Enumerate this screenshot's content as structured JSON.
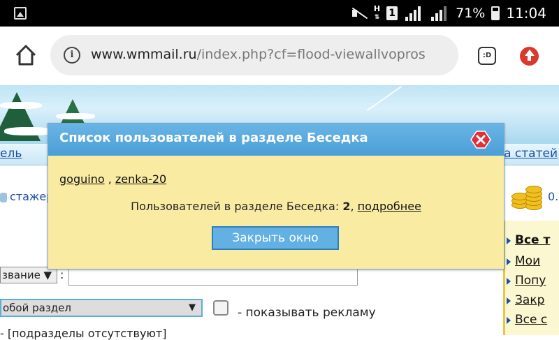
{
  "status_bar": {
    "network_letter": "H",
    "sim_number": "1",
    "battery_percent": "71%",
    "time": "11:04"
  },
  "browser": {
    "url_host": "www.wmmail.ru",
    "url_path": "/index.php?cf=flood-viewallvopros",
    "extension_label": ":D"
  },
  "page": {
    "menu_left": "ель",
    "menu_right": "а статей",
    "user_snippet": "стажер",
    "coins_value": "0.",
    "sidebar_links": [
      "Все т",
      "Мои",
      "Попу",
      "Закр",
      "Все с"
    ],
    "sort_select_value": "звание ▼",
    "colon": ":",
    "section_select_value": "обой раздел",
    "section_select_arrow": "▼",
    "ad_checkbox_label": "- показывать рекламу",
    "cut_line": "- [подразделы отсутствуют]"
  },
  "modal": {
    "title": "Список пользователей в разделе Беседка",
    "users": [
      "goguino",
      "zenka-20"
    ],
    "users_separator": " , ",
    "count_text": "Пользователей в разделе Беседка: ",
    "count_value": "2",
    "count_sep": ", ",
    "details_link": "подробнее",
    "close_button": "Закрыть окно"
  }
}
